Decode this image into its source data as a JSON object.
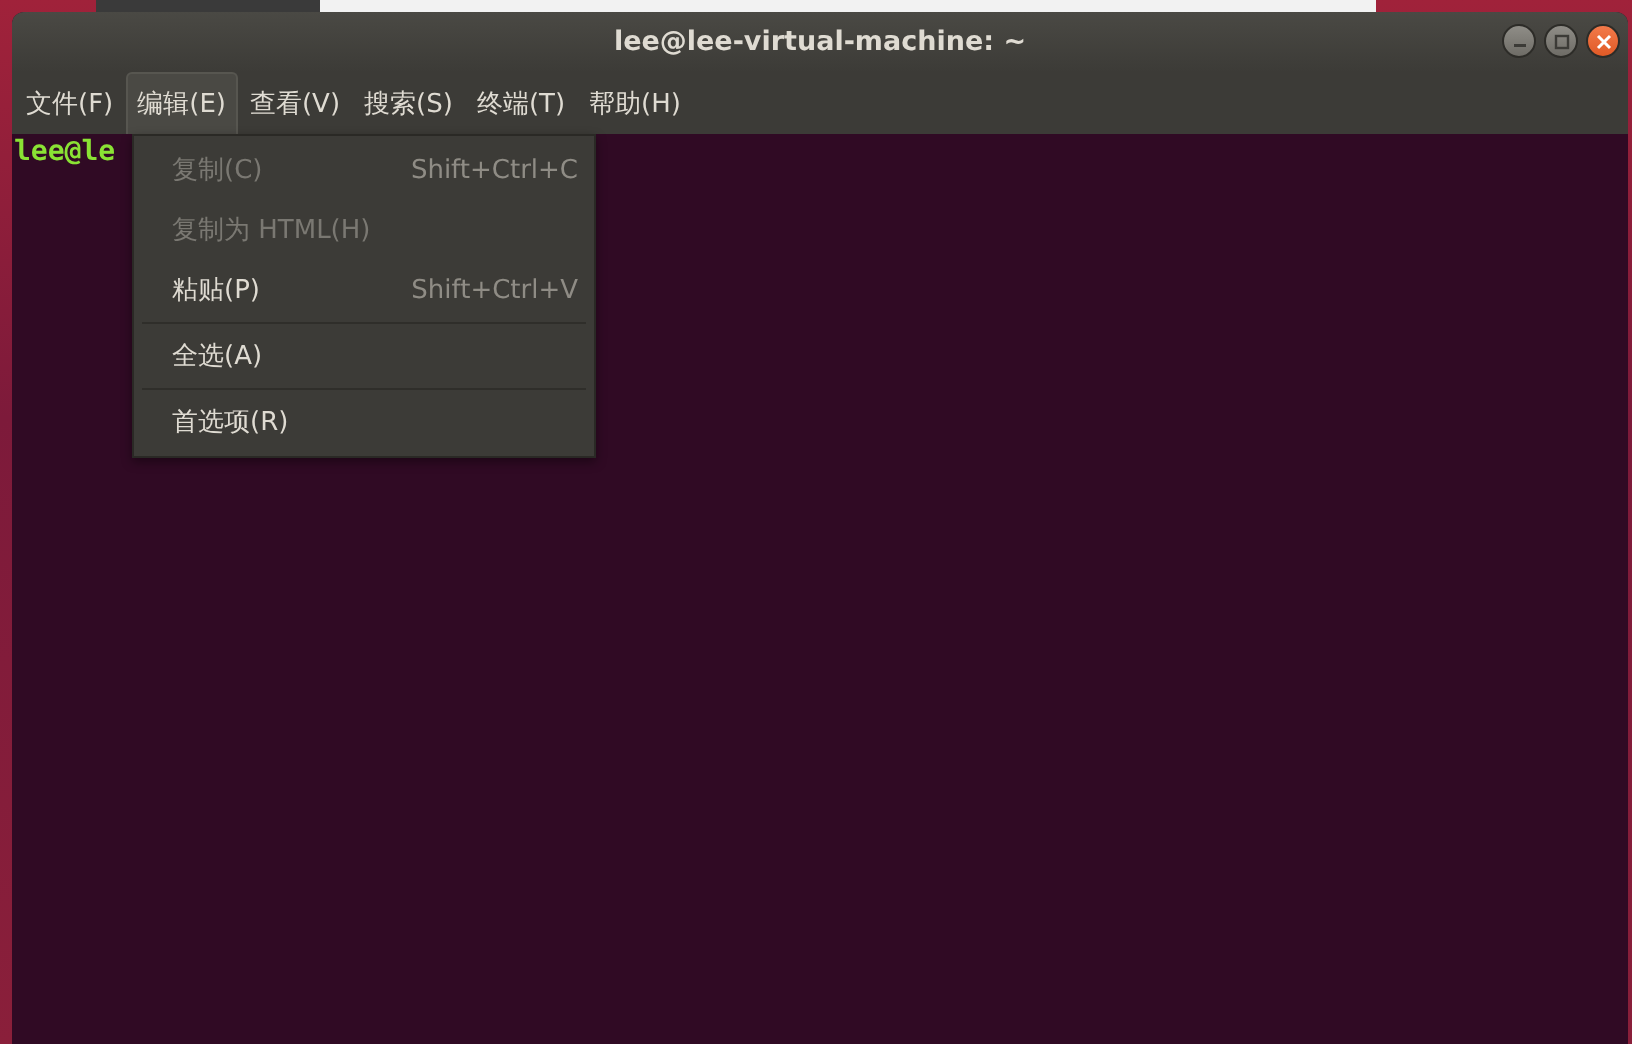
{
  "window": {
    "title": "lee@lee-virtual-machine: ~"
  },
  "menu_bar": [
    {
      "label": "文件(F)",
      "selected": false
    },
    {
      "label": "编辑(E)",
      "selected": true
    },
    {
      "label": "查看(V)",
      "selected": false
    },
    {
      "label": "搜索(S)",
      "selected": false
    },
    {
      "label": "终端(T)",
      "selected": false
    },
    {
      "label": "帮助(H)",
      "selected": false
    }
  ],
  "terminal": {
    "prompt": "lee@le"
  },
  "edit_menu": [
    {
      "kind": "item",
      "label": "复制(C)",
      "shortcut": "Shift+Ctrl+C",
      "disabled": true
    },
    {
      "kind": "item",
      "label": "复制为 HTML(H)",
      "disabled": true
    },
    {
      "kind": "item",
      "label": "粘贴(P)",
      "shortcut": "Shift+Ctrl+V",
      "disabled": false
    },
    {
      "kind": "separator"
    },
    {
      "kind": "item",
      "label": "全选(A)",
      "disabled": false
    },
    {
      "kind": "separator"
    },
    {
      "kind": "item",
      "label": "首选项(R)",
      "disabled": false
    }
  ]
}
